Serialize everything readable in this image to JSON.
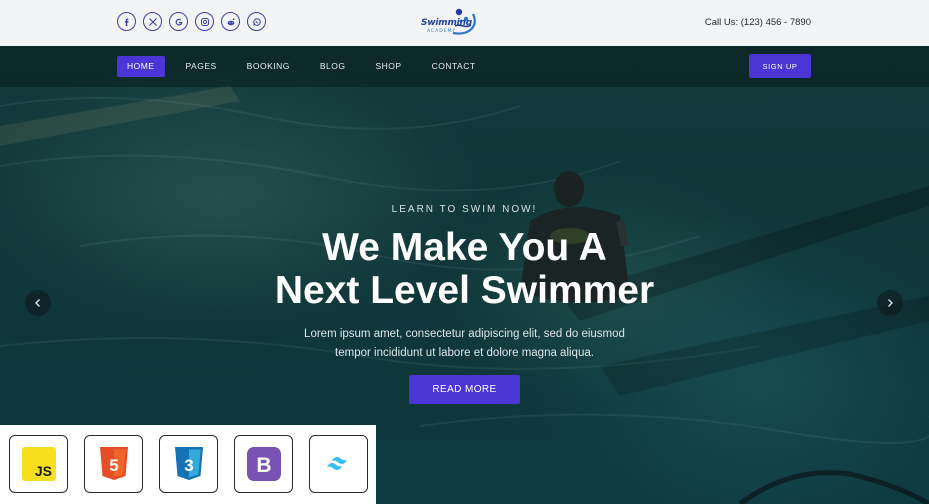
{
  "header": {
    "social_icons": [
      "facebook-icon",
      "x-twitter-icon",
      "google-icon",
      "instagram-icon",
      "reddit-icon",
      "whatsapp-icon"
    ],
    "logo": {
      "word": "Swimming",
      "sub": "ACADEMY"
    },
    "call": "Call Us: (123) 456 - 7890"
  },
  "nav": {
    "items": [
      {
        "label": "HOME",
        "active": true
      },
      {
        "label": "PAGES"
      },
      {
        "label": "BOOKING"
      },
      {
        "label": "BLOG"
      },
      {
        "label": "SHOP"
      },
      {
        "label": "CONTACT"
      }
    ],
    "signup_label": "SIGN UP"
  },
  "hero": {
    "eyebrow": "LEARN TO SWIM NOW!",
    "headline_line1": "We Make You A",
    "headline_line2": "Next Level Swimmer",
    "lede_line1": "Lorem ipsum amet, consectetur adipiscing elit, sed do eiusmod",
    "lede_line2": "tempor incididunt ut labore et dolore magna aliqua.",
    "cta_label": "READ MORE",
    "prev_icon": "chevron-left-icon",
    "next_icon": "chevron-right-icon"
  },
  "tech_badges": [
    {
      "name": "javascript-icon",
      "label": "JS",
      "color": "#f7df1e"
    },
    {
      "name": "html5-icon",
      "label": "5",
      "color": "#e44d26"
    },
    {
      "name": "css3-icon",
      "label": "3",
      "color": "#2965f1"
    },
    {
      "name": "bootstrap-icon",
      "label": "B",
      "color": "#7952b3"
    },
    {
      "name": "tailwind-icon",
      "label": "",
      "color": "#38bdf8"
    }
  ],
  "colors": {
    "accent": "#4b35d6",
    "topbar": "#f3f4f6",
    "social": "#3b3fae"
  }
}
